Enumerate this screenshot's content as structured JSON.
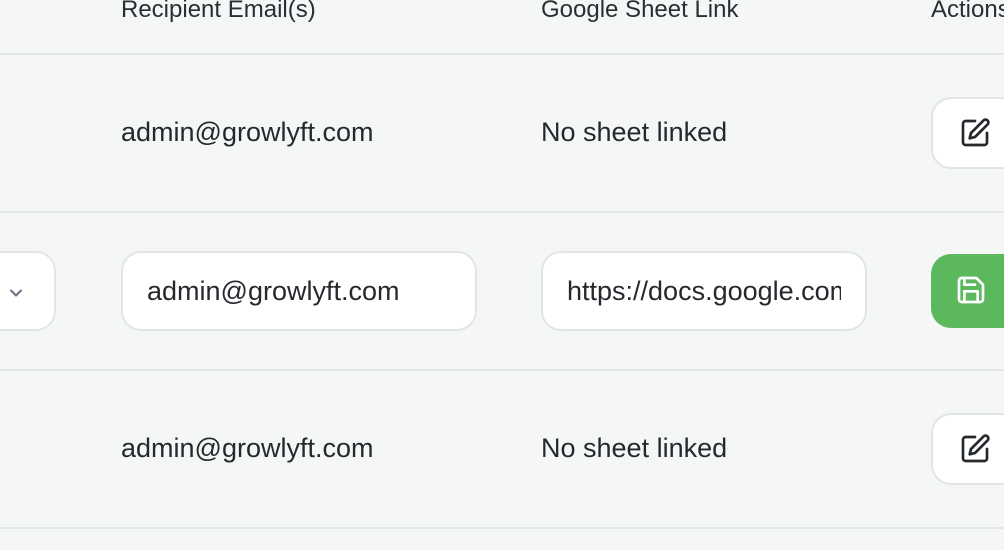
{
  "table": {
    "headers": {
      "recipients": "Recipient Email(s)",
      "sheet": "Google Sheet Link",
      "actions": "Actions"
    },
    "rows": [
      {
        "mode": "view",
        "email": "admin@growlyft.com",
        "sheet": "No sheet linked",
        "action_icon": "edit-icon"
      },
      {
        "mode": "edit",
        "email": "admin@growlyft.com",
        "sheet": "https://docs.google.com",
        "action_icon": "save-icon",
        "select_icon": "chevron-down-icon"
      },
      {
        "mode": "view",
        "email": "admin@growlyft.com",
        "sheet": "No sheet linked",
        "action_icon": "edit-icon"
      }
    ]
  },
  "colors": {
    "background": "#f5f7f7",
    "divider": "#e3e7ea",
    "save_button": "#5cb85c",
    "input_border": "#e1e5ea"
  }
}
